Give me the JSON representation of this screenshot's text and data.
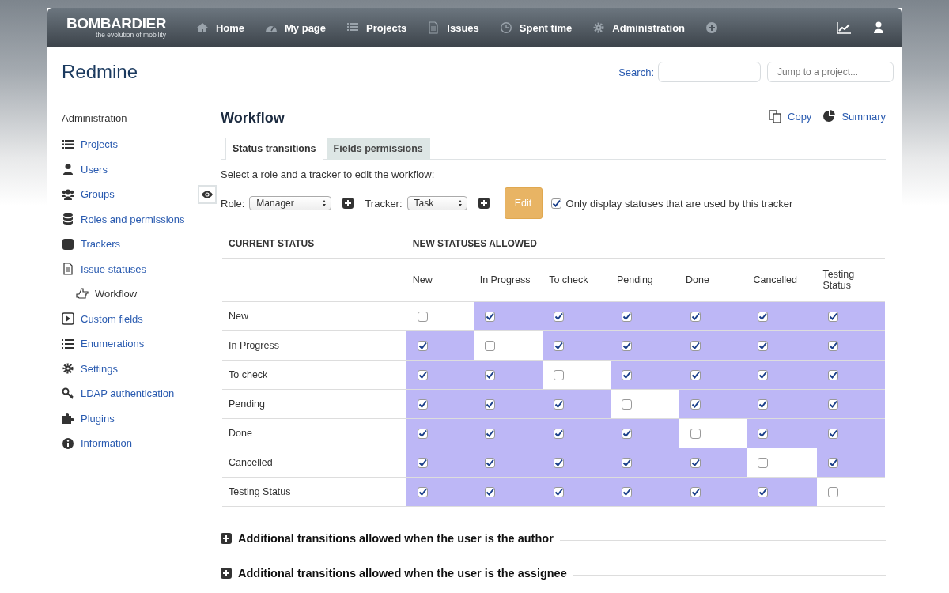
{
  "header": {
    "logo": "BOMBARDIER",
    "logo_tagline": "the evolution of mobility",
    "menu": [
      {
        "label": "Home"
      },
      {
        "label": "My page"
      },
      {
        "label": "Projects"
      },
      {
        "label": "Issues"
      },
      {
        "label": "Spent time"
      },
      {
        "label": "Administration"
      }
    ]
  },
  "site_title": "Redmine",
  "search": {
    "label": "Search:"
  },
  "project_jump": {
    "placeholder": "Jump to a project..."
  },
  "sidebar": {
    "title": "Administration",
    "items": [
      {
        "label": "Projects",
        "selected": false
      },
      {
        "label": "Users",
        "selected": false
      },
      {
        "label": "Groups",
        "selected": false
      },
      {
        "label": "Roles and permissions",
        "selected": false
      },
      {
        "label": "Trackers",
        "selected": false
      },
      {
        "label": "Issue statuses",
        "selected": false,
        "children": [
          {
            "label": "Workflow",
            "selected": true
          }
        ]
      },
      {
        "label": "Custom fields",
        "selected": false
      },
      {
        "label": "Enumerations",
        "selected": false
      },
      {
        "label": "Settings",
        "selected": false
      },
      {
        "label": "LDAP authentication",
        "selected": false
      },
      {
        "label": "Plugins",
        "selected": false
      },
      {
        "label": "Information",
        "selected": false
      }
    ]
  },
  "page_title": "Workflow",
  "actions": [
    {
      "label": "Copy"
    },
    {
      "label": "Summary"
    }
  ],
  "tabs": [
    {
      "label": "Status transitions",
      "selected": true
    },
    {
      "label": "Fields permissions",
      "selected": false
    }
  ],
  "instruction": "Select a role and a tracker to edit the workflow:",
  "filters": {
    "role_label": "Role:",
    "role_value": "Manager",
    "tracker_label": "Tracker:",
    "tracker_value": "Task",
    "edit_button": "Edit",
    "only_used": {
      "label": "Only display statuses that are used by this tracker",
      "checked": true
    }
  },
  "table": {
    "header_current": "CURRENT STATUS",
    "header_new": "NEW STATUSES ALLOWED",
    "columns": [
      "New",
      "In Progress",
      "To check",
      "Pending",
      "Done",
      "Cancelled",
      "Testing Status"
    ],
    "rows": [
      {
        "status": "New",
        "cells": [
          {
            "checked": false
          },
          {
            "checked": true
          },
          {
            "checked": true
          },
          {
            "checked": true
          },
          {
            "checked": true
          },
          {
            "checked": true
          },
          {
            "checked": true
          }
        ]
      },
      {
        "status": "In Progress",
        "cells": [
          {
            "checked": true
          },
          {
            "checked": false
          },
          {
            "checked": true
          },
          {
            "checked": true
          },
          {
            "checked": true
          },
          {
            "checked": true
          },
          {
            "checked": true
          }
        ]
      },
      {
        "status": "To check",
        "cells": [
          {
            "checked": true
          },
          {
            "checked": true
          },
          {
            "checked": false
          },
          {
            "checked": true
          },
          {
            "checked": true
          },
          {
            "checked": true
          },
          {
            "checked": true
          }
        ]
      },
      {
        "status": "Pending",
        "cells": [
          {
            "checked": true
          },
          {
            "checked": true
          },
          {
            "checked": true
          },
          {
            "checked": false
          },
          {
            "checked": true
          },
          {
            "checked": true
          },
          {
            "checked": true
          }
        ]
      },
      {
        "status": "Done",
        "cells": [
          {
            "checked": true
          },
          {
            "checked": true
          },
          {
            "checked": true
          },
          {
            "checked": true
          },
          {
            "checked": false
          },
          {
            "checked": true
          },
          {
            "checked": true
          }
        ]
      },
      {
        "status": "Cancelled",
        "cells": [
          {
            "checked": true
          },
          {
            "checked": true
          },
          {
            "checked": true
          },
          {
            "checked": true
          },
          {
            "checked": true
          },
          {
            "checked": false
          },
          {
            "checked": true
          }
        ]
      },
      {
        "status": "Testing Status",
        "cells": [
          {
            "checked": true
          },
          {
            "checked": true
          },
          {
            "checked": true
          },
          {
            "checked": true
          },
          {
            "checked": true
          },
          {
            "checked": true
          },
          {
            "checked": false
          }
        ]
      }
    ]
  },
  "sections": [
    {
      "label": "Additional transitions allowed when the user is the author",
      "expanded": false
    },
    {
      "label": "Additional transitions allowed when the user is the assignee",
      "expanded": false
    }
  ]
}
